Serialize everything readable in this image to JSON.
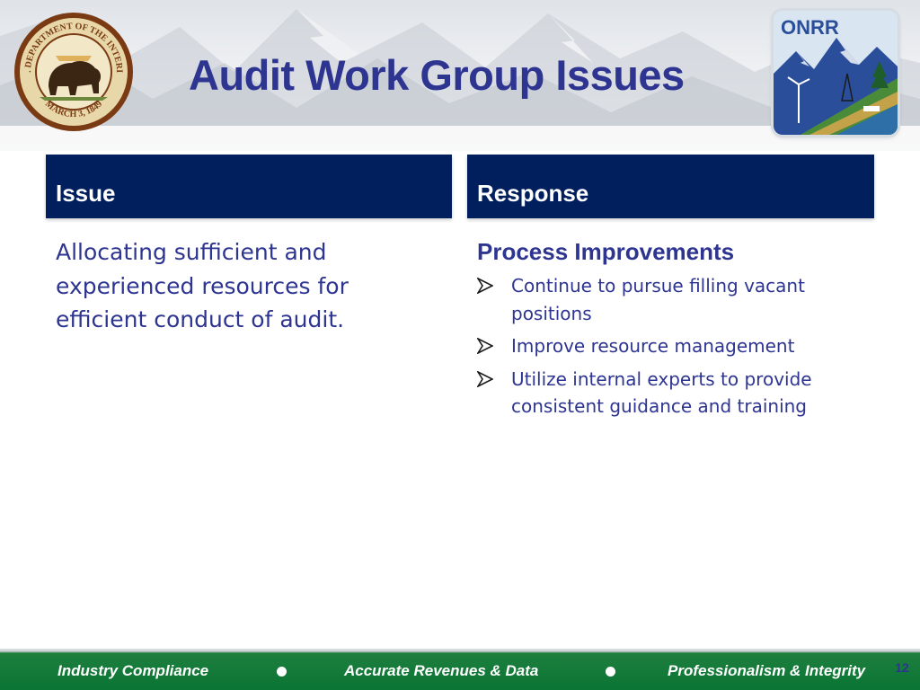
{
  "slide": {
    "title": "Audit Work Group Issues",
    "page_number": "12"
  },
  "seal": {
    "ring_text_top": "U.S. DEPARTMENT OF THE INTERIOR",
    "ring_text_bottom": "MARCH 3, 1849",
    "icon": "bison-seal-icon"
  },
  "logo": {
    "text": "ONRR",
    "icon": "onrr-logo-icon"
  },
  "columns": {
    "issue_header": "Issue",
    "response_header": "Response"
  },
  "issue": {
    "text": "Allocating sufficient and experienced resources for efficient conduct of audit."
  },
  "response": {
    "heading": "Process Improvements",
    "bullets": [
      "Continue to pursue filling vacant positions",
      "Improve resource management",
      "Utilize internal experts to provide consistent guidance and training"
    ],
    "bullet_icon": "arrowhead-bullet-icon"
  },
  "footer": {
    "items": [
      "Industry Compliance",
      "Accurate Revenues & Data",
      "Professionalism & Integrity"
    ]
  },
  "colors": {
    "title": "#2e3591",
    "header_fill": "#001f5c",
    "footer_green": "#0a7534",
    "body_text": "#2e3591"
  }
}
